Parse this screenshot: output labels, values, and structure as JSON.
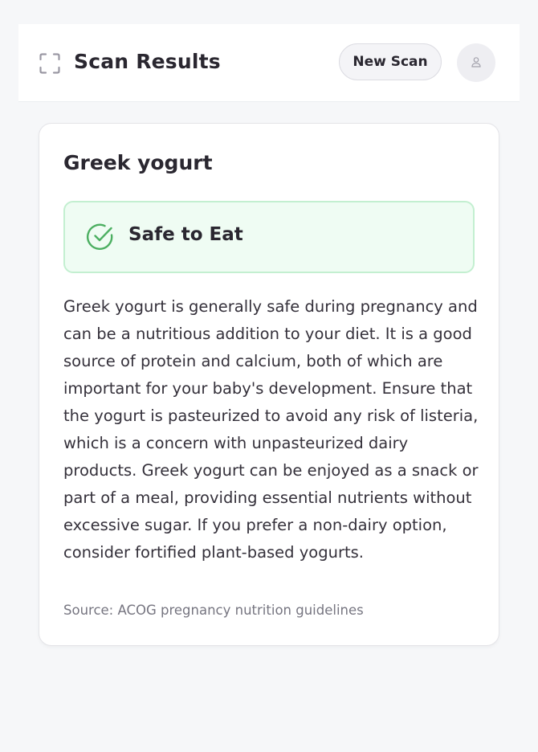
{
  "header": {
    "title": "Scan Results",
    "new_scan_label": "New Scan",
    "scan_icon": "scan-frame-icon",
    "avatar_icon": "user-icon"
  },
  "result": {
    "food_name": "Greek yogurt",
    "status": {
      "label": "Safe to Eat",
      "icon": "check-circle-icon",
      "color": "#4caf61",
      "background": "#effcf3",
      "border": "#c3efd0"
    },
    "description": "Greek yogurt is generally safe during pregnancy and can be a nutritious addition to your diet. It is a good source of protein and calcium, both of which are important for your baby's development. Ensure that the yogurt is pasteurized to avoid any risk of listeria, which is a concern with unpasteurized dairy products. Greek yogurt can be enjoyed as a snack or part of a meal, providing essential nutrients without excessive sugar. If you prefer a non-dairy option, consider fortified plant-based yogurts.",
    "source": "Source: ACOG pregnancy nutrition guidelines"
  }
}
